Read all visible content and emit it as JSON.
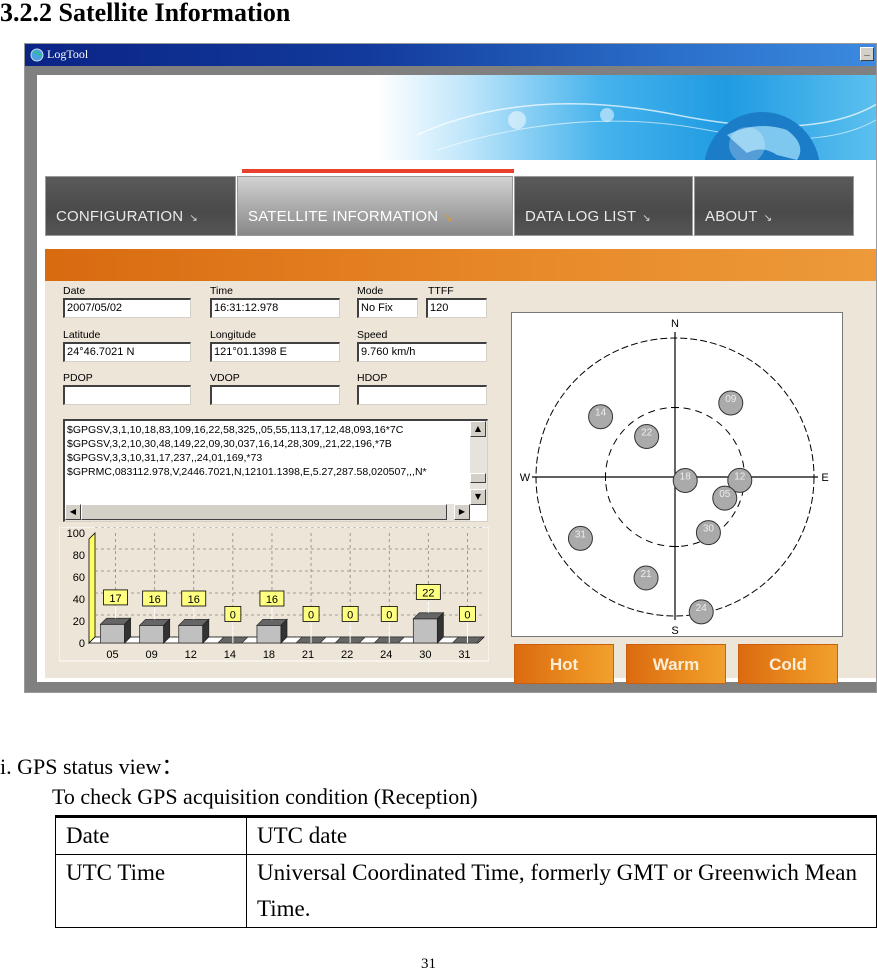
{
  "heading": "3.2.2 Satellite Information",
  "window": {
    "title": "LogTool",
    "minimize_label": "_"
  },
  "nav": {
    "tabs": [
      {
        "label": "CONFIGURATION",
        "arrow": "↘",
        "active": false
      },
      {
        "label": "SATELLITE  INFORMATION",
        "arrow": "↘",
        "active": true
      },
      {
        "label": "DATA  LOG  LIST",
        "arrow": "↘",
        "active": false
      },
      {
        "label": "ABOUT",
        "arrow": "↘",
        "active": false
      }
    ],
    "active_color": "#e8402a"
  },
  "status": {
    "date_label": "Date",
    "date_value": "2007/05/02",
    "time_label": "Time",
    "time_value": "16:31:12.978",
    "mode_label": "Mode",
    "mode_value": "No Fix",
    "ttff_label": "TTFF",
    "ttff_value": "120",
    "latitude_label": "Latitude",
    "latitude_value": "24°46.7021 N",
    "longitude_label": "Longitude",
    "longitude_value": "121°01.1398 E",
    "speed_label": "Speed",
    "speed_value": "9.760 km/h",
    "pdop_label": "PDOP",
    "pdop_value": "",
    "vdop_label": "VDOP",
    "vdop_value": "",
    "hdop_label": "HDOP",
    "hdop_value": ""
  },
  "nmea": {
    "lines": [
      "$GPGSV,3,1,10,18,83,109,16,22,58,325,,05,55,113,17,12,48,093,16*7C",
      "$GPGSV,3,2,10,30,48,149,22,09,30,037,16,14,28,309,,21,22,196,*7B",
      "$GPGSV,3,3,10,31,17,237,,24,01,169,*73",
      "$GPRMC,083112.978,V,2446.7021,N,12101.1398,E,5.27,287.58,020507,,,N*"
    ]
  },
  "chart_data": {
    "type": "bar",
    "title": "",
    "xlabel": "",
    "ylabel": "",
    "categories": [
      "05",
      "09",
      "12",
      "14",
      "18",
      "21",
      "22",
      "24",
      "30",
      "31"
    ],
    "values": [
      17,
      16,
      16,
      0,
      16,
      0,
      0,
      0,
      22,
      0
    ],
    "ylim": [
      0,
      100
    ],
    "yticks": [
      0,
      20,
      40,
      60,
      80,
      100
    ],
    "grid": true,
    "data_labels": true,
    "label_color": "#ffff80",
    "bar_color": "#c0c0c0"
  },
  "skyplot": {
    "directions": {
      "n": "N",
      "s": "S",
      "e": "E",
      "w": "W"
    },
    "satellites": [
      {
        "prn": "09",
        "azimuth": 37,
        "elevation": 30
      },
      {
        "prn": "14",
        "azimuth": 309,
        "elevation": 28
      },
      {
        "prn": "22",
        "azimuth": 325,
        "elevation": 58
      },
      {
        "prn": "18",
        "azimuth": 109,
        "elevation": 83
      },
      {
        "prn": "12",
        "azimuth": 93,
        "elevation": 48
      },
      {
        "prn": "05",
        "azimuth": 113,
        "elevation": 55
      },
      {
        "prn": "30",
        "azimuth": 149,
        "elevation": 48
      },
      {
        "prn": "31",
        "azimuth": 237,
        "elevation": 17
      },
      {
        "prn": "21",
        "azimuth": 196,
        "elevation": 22
      },
      {
        "prn": "24",
        "azimuth": 169,
        "elevation": 1
      }
    ]
  },
  "buttons": {
    "hot": "Hot",
    "warm": "Warm",
    "cold": "Cold"
  },
  "doc": {
    "item_title": "i. GPS status view：",
    "intro": "To check GPS acquisition condition (Reception)",
    "table": [
      {
        "term": "Date",
        "desc": "UTC date"
      },
      {
        "term": "UTC Time",
        "desc": "Universal Coordinated Time, formerly GMT or Greenwich Mean Time."
      }
    ],
    "page_number": "31"
  }
}
